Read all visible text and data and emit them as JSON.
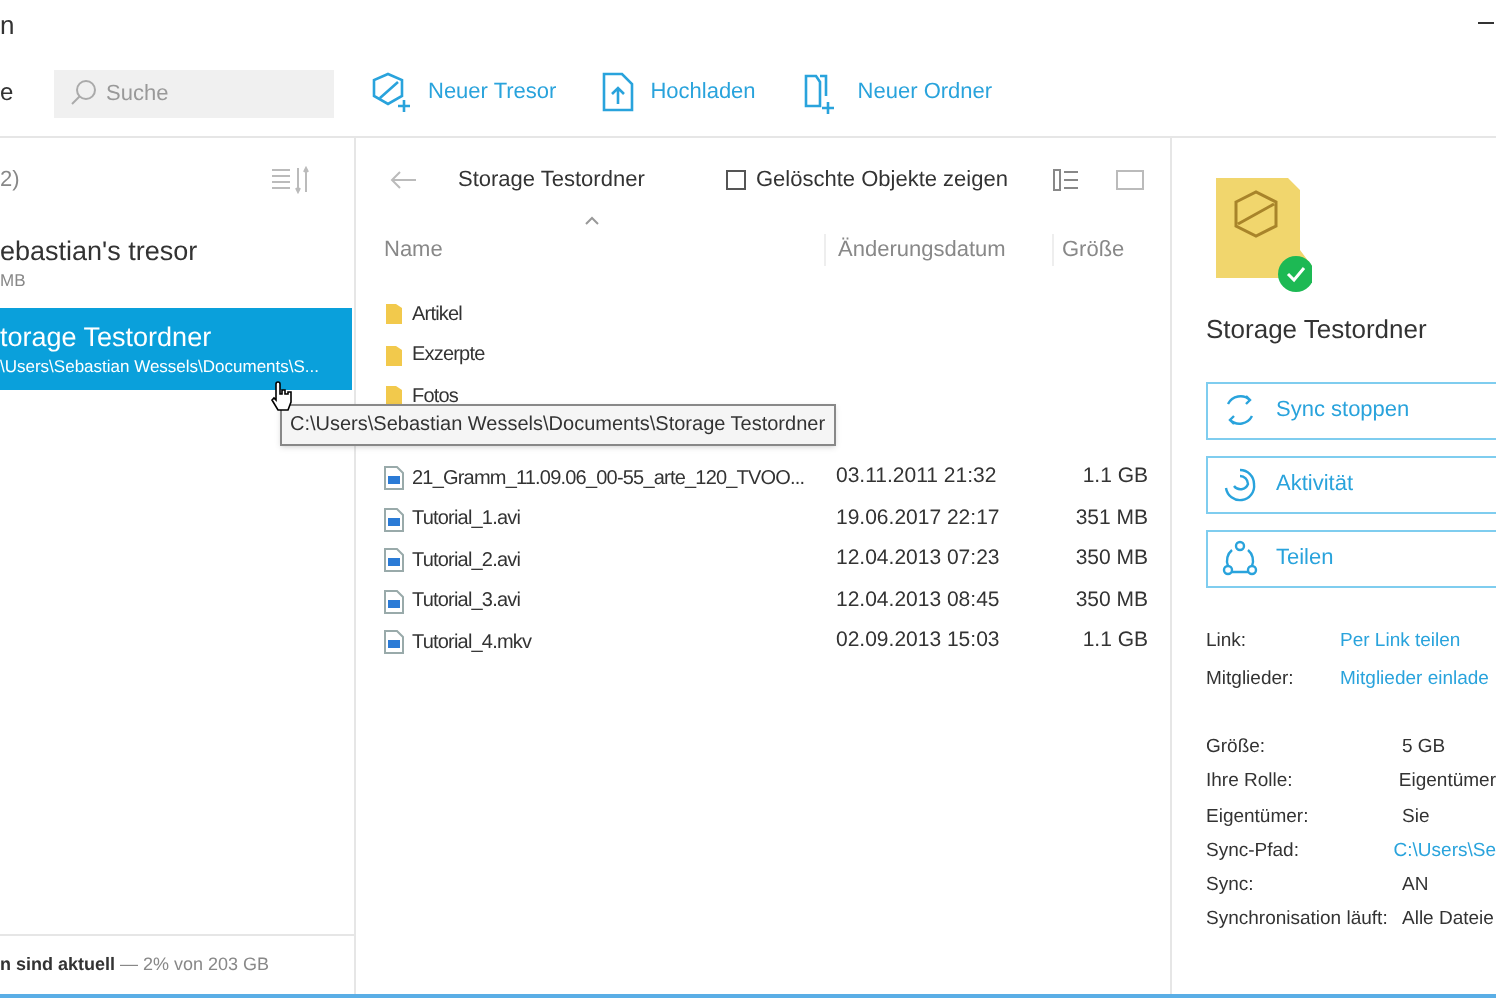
{
  "window": {
    "title": "n"
  },
  "toolbar": {
    "left_fragment": "e",
    "search": {
      "placeholder": "Suche"
    },
    "actions": [
      {
        "label": "Neuer Tresor",
        "kind": "vault"
      },
      {
        "label": "Hochladen",
        "kind": "upload"
      },
      {
        "label": "Neuer Ordner",
        "kind": "folder"
      }
    ]
  },
  "sidebar": {
    "header": "2)",
    "items": [
      {
        "name": "ebastian's tresor",
        "sub": "MB",
        "selected": false
      },
      {
        "name": "torage Testordner",
        "sub": "\\Users\\Sebastian Wessels\\Documents\\S...",
        "selected": true
      }
    ],
    "status": "**n sind aktuell** — 2% von 203 GB"
  },
  "browser": {
    "path": "Storage Testordner",
    "show_deleted": {
      "label": "Gelöschte Objekte zeigen",
      "checked": false
    },
    "columns": [
      "Name",
      "Änderungsdatum",
      "Größe"
    ],
    "rows": [
      {
        "name": "Artikel",
        "kind": "folder",
        "date": "",
        "size": ""
      },
      {
        "name": "Exzerpte",
        "kind": "folder",
        "date": "",
        "size": ""
      },
      {
        "name": "Fotos",
        "kind": "folder",
        "date": "",
        "size": ""
      },
      {
        "name": "",
        "kind": "hidden",
        "date": "",
        "size": ""
      },
      {
        "name": "21_Gramm_11.09.06_00-55_arte_120_TVOO...",
        "kind": "video",
        "date": "03.11.2011 21:32",
        "size": "1.1 GB"
      },
      {
        "name": "Tutorial_1.avi",
        "kind": "video",
        "date": "19.06.2017 22:17",
        "size": "351 MB"
      },
      {
        "name": "Tutorial_2.avi",
        "kind": "video",
        "date": "12.04.2013 07:23",
        "size": "350 MB"
      },
      {
        "name": "Tutorial_3.avi",
        "kind": "video",
        "date": "12.04.2013 08:45",
        "size": "350 MB"
      },
      {
        "name": "Tutorial_4.mkv",
        "kind": "video",
        "date": "02.09.2013 15:03",
        "size": "1.1 GB"
      }
    ],
    "tooltip": "C:\\Users\\Sebastian Wessels\\Documents\\Storage Testordner"
  },
  "details": {
    "title": "Storage Testordner",
    "buttons": [
      {
        "label": "Sync stoppen",
        "kind": "sync"
      },
      {
        "label": "Aktivität",
        "kind": "activity"
      },
      {
        "label": "Teilen",
        "kind": "share"
      }
    ],
    "links": [
      {
        "label": "Link:",
        "value": "Per Link teilen"
      },
      {
        "label": "Mitglieder:",
        "value": "Mitglieder einlade"
      }
    ],
    "properties": [
      {
        "label": "Größe:",
        "value": "5 GB",
        "link": false
      },
      {
        "label": "Ihre Rolle:",
        "value": "Eigentümer",
        "link": false
      },
      {
        "label": "Eigentümer:",
        "value": "Sie",
        "link": false
      },
      {
        "label": "Sync-Pfad:",
        "value": "C:\\Users\\Se",
        "link": true
      },
      {
        "label": "Sync:",
        "value": "AN",
        "link": false
      },
      {
        "label": "Synchronisation läuft:",
        "value": "Alle Dateie",
        "link": false
      }
    ]
  }
}
